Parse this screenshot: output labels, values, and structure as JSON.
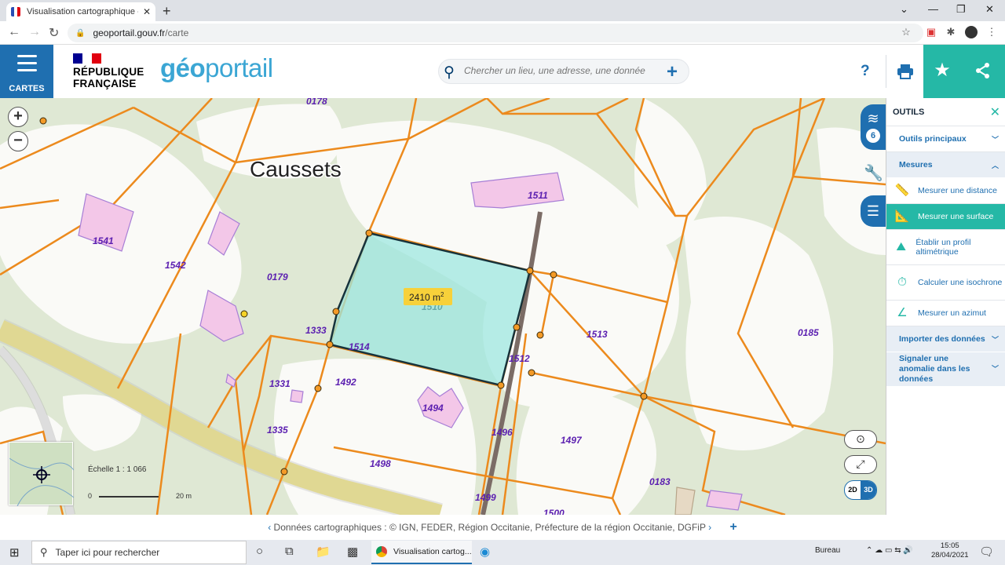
{
  "browser": {
    "tab_title": "Visualisation cartographique - Gé",
    "url_host": "geoportail.gouv.fr",
    "url_path": "/carte"
  },
  "header": {
    "cartes_label": "CARTES",
    "rf_line1": "RÉPUBLIQUE",
    "rf_line2": "FRANÇAISE",
    "logo_geo": "géo",
    "logo_portail": "portail",
    "search_placeholder": "Chercher un lieu, une adresse, une donnée",
    "help": "?"
  },
  "map": {
    "place_name": "Caussets",
    "measure_value": "2410 m",
    "measure_exp": "2",
    "parcels": {
      "p0178": "0178",
      "p1511": "1511",
      "p1541": "1541",
      "p1542": "1542",
      "p0179": "0179",
      "p1510": "1510",
      "p1333": "1333",
      "p1514": "1514",
      "p1513": "1513",
      "p0185": "0185",
      "p1512": "1512",
      "p1331": "1331",
      "p1492": "1492",
      "p1494": "1494",
      "p1335": "1335",
      "p1496": "1496",
      "p1497": "1497",
      "p1498": "1498",
      "p0183": "0183",
      "p1499": "1499",
      "p1500": "1500"
    },
    "scale_label": "Échelle 1 : 1 066",
    "scale_zero": "0",
    "scale_max": "20 m",
    "layers_count": "6",
    "btn_2d": "2D",
    "btn_3d": "3D"
  },
  "outils": {
    "title": "OUTILS",
    "sections": {
      "principaux": "Outils principaux",
      "mesures": "Mesures",
      "importer": "Importer des données",
      "signaler": "Signaler une anomalie dans les données"
    },
    "items": {
      "distance": "Mesurer une distance",
      "surface": "Mesurer une surface",
      "profil": "Établir un profil altimétrique",
      "isochrone": "Calculer une isochrone",
      "azimut": "Mesurer un azimut"
    }
  },
  "attribution": "Données cartographiques : © IGN,  FEDER,  Région Occitanie,  Préfecture de la région Occitanie,  DGFiP",
  "taskbar": {
    "search": "Taper ici pour rechercher",
    "chrome_label": "Visualisation cartog...",
    "desktop": "Bureau",
    "time": "15:05",
    "date": "28/04/2021"
  }
}
